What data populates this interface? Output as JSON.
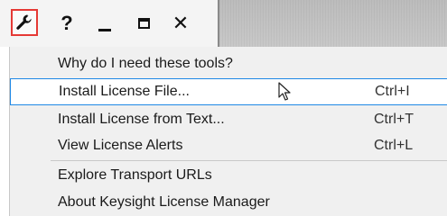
{
  "toolbar": {
    "wrench_icon": "wrench-icon",
    "help_label": "?",
    "minimize_icon": "minimize-icon",
    "maximize_icon": "maximize-icon",
    "close_label": "✕"
  },
  "menu": {
    "items": [
      {
        "label": "Why do I need these tools?",
        "shortcut": ""
      },
      {
        "label": "Install License File...",
        "shortcut": "Ctrl+I"
      },
      {
        "label": "Install License from Text...",
        "shortcut": "Ctrl+T"
      },
      {
        "label": "View License Alerts",
        "shortcut": "Ctrl+L"
      },
      {
        "label": "Explore Transport URLs",
        "shortcut": ""
      },
      {
        "label": "About Keysight License Manager",
        "shortcut": ""
      }
    ]
  },
  "colors": {
    "highlight_border": "#1e88e5",
    "active_tool_border": "#e53935",
    "menu_background": "#f0f0f0"
  }
}
